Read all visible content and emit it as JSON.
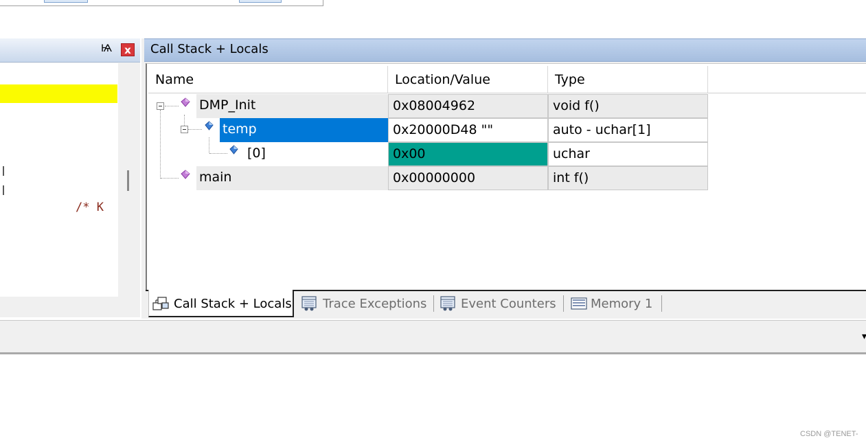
{
  "right_panel": {
    "title": "Call Stack + Locals"
  },
  "left_panel": {
    "pin_glyph": "Ѩ",
    "close_glyph": "x",
    "code_snippet": "/* K"
  },
  "columns": [
    {
      "label": "Name"
    },
    {
      "label": "Location/Value"
    },
    {
      "label": "Type"
    }
  ],
  "rows": [
    {
      "name": "DMP_Init",
      "value": "0x08004962",
      "type": "void f()"
    },
    {
      "name": "temp",
      "value": "0x20000D48 \"\"",
      "type": "auto - uchar[1]"
    },
    {
      "name": "[0]",
      "value": "0x00",
      "type": "uchar"
    },
    {
      "name": "main",
      "value": "0x00000000",
      "type": "int f()"
    }
  ],
  "tabs": [
    {
      "label": "Call Stack + Locals",
      "icon": "call-stack-icon",
      "active": true
    },
    {
      "label": "Trace Exceptions",
      "icon": "trace-icon",
      "active": false
    },
    {
      "label": "Event Counters",
      "icon": "counters-icon",
      "active": false
    },
    {
      "label": "Memory 1",
      "icon": "memory-icon",
      "active": false
    }
  ],
  "colors": {
    "selected_row": "#0078d7",
    "changed_value": "#00a08f",
    "current_line": "#fbfb00",
    "header_gradient": "#b5cae7"
  },
  "watermark": "CSDN @TENET-"
}
